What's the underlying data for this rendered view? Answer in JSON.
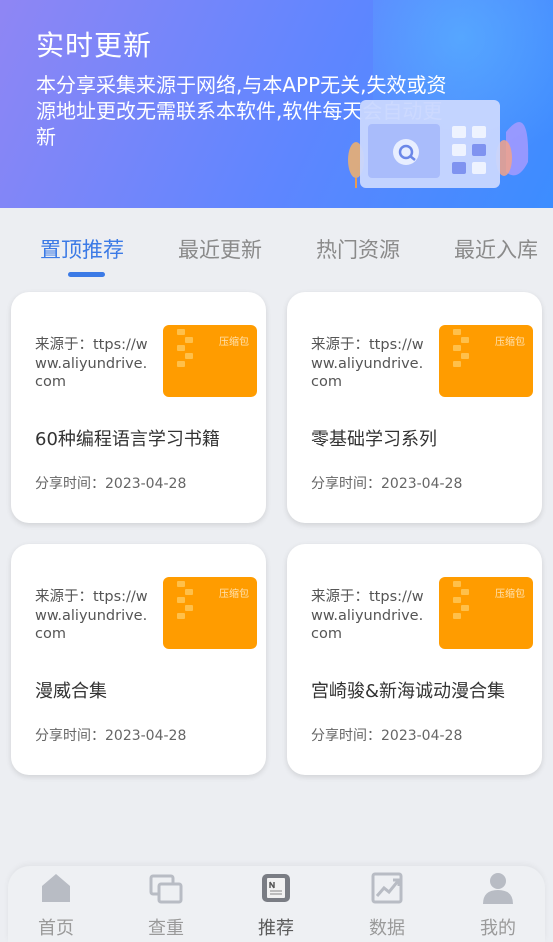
{
  "banner": {
    "title": "实时更新",
    "description": "本分享采集来源于网络,与本APP无关,失效或资源地址更改无需联系本软件,软件每天会自动更新"
  },
  "tabs": [
    {
      "label": "置顶推荐",
      "active": true
    },
    {
      "label": "最近更新",
      "active": false
    },
    {
      "label": "热门资源",
      "active": false
    },
    {
      "label": "最近入库",
      "active": false
    }
  ],
  "cards": [
    {
      "source": "来源于：ttps://www.aliyundrive.com",
      "thumb_label": "压缩包",
      "title": "60种编程语言学习书籍",
      "time": "分享时间：2023-04-28"
    },
    {
      "source": "来源于：ttps://www.aliyundrive.com",
      "thumb_label": "压缩包",
      "title": "零基础学习系列",
      "time": "分享时间：2023-04-28"
    },
    {
      "source": "来源于：ttps://www.aliyundrive.com",
      "thumb_label": "压缩包",
      "title": "漫威合集",
      "time": "分享时间：2023-04-28"
    },
    {
      "source": "来源于：ttps://www.aliyundrive.com",
      "thumb_label": "压缩包",
      "title": "宫崎骏&新海诚动漫合集",
      "time": "分享时间：2023-04-28"
    }
  ],
  "bottom_nav": [
    {
      "label": "首页",
      "icon": "home-icon",
      "active": false
    },
    {
      "label": "查重",
      "icon": "duplicate-check-icon",
      "active": false
    },
    {
      "label": "推荐",
      "icon": "recommend-icon",
      "active": true
    },
    {
      "label": "数据",
      "icon": "chart-icon",
      "active": false
    },
    {
      "label": "我的",
      "icon": "user-icon",
      "active": false
    }
  ],
  "colors": {
    "accent": "#3b7ae6",
    "thumb": "#ff9c00",
    "banner_start": "#8f86f4",
    "banner_end": "#3c8dff"
  }
}
